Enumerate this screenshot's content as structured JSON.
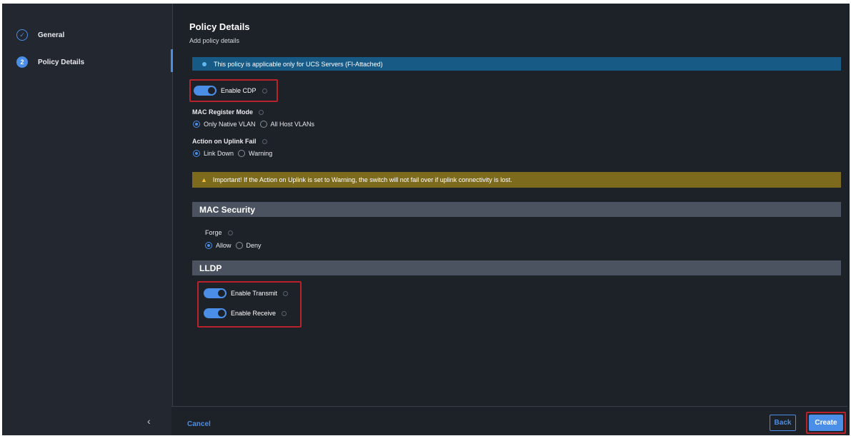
{
  "steps": [
    {
      "number": "",
      "label": "General",
      "state": "done"
    },
    {
      "number": "2",
      "label": "Policy Details",
      "state": "active"
    }
  ],
  "collapse_icon": "chevron-left-icon",
  "header": {
    "title": "Policy Details",
    "subtitle": "Add policy details"
  },
  "info_banner": {
    "text": "This policy is applicable only for UCS Servers (FI-Attached)",
    "color": "#185a86"
  },
  "enable_cdp": {
    "label": "Enable CDP",
    "enabled": true
  },
  "mac_register_mode": {
    "label": "MAC Register Mode",
    "options": [
      "Only Native VLAN",
      "All Host VLANs"
    ],
    "selected": "Only Native VLAN"
  },
  "action_on_uplink_fail": {
    "label": "Action on Uplink Fail",
    "options": [
      "Link Down",
      "Warning"
    ],
    "selected": "Link Down"
  },
  "warning_banner": {
    "text": "Important! If the Action on Uplink is set to Warning, the switch will not fail over if uplink connectivity is lost.",
    "color": "#7d6a1d"
  },
  "mac_security": {
    "title": "MAC Security",
    "forge": {
      "label": "Forge",
      "options": [
        "Allow",
        "Deny"
      ],
      "selected": "Allow"
    }
  },
  "lldp": {
    "title": "LLDP",
    "enable_transmit": {
      "label": "Enable Transmit",
      "enabled": true
    },
    "enable_receive": {
      "label": "Enable Receive",
      "enabled": true
    }
  },
  "footer": {
    "cancel_label": "Cancel",
    "back_label": "Back",
    "create_label": "Create"
  },
  "colors": {
    "accent": "#4a8ee8",
    "highlight": "#b8232b",
    "background": "#1d2128"
  }
}
